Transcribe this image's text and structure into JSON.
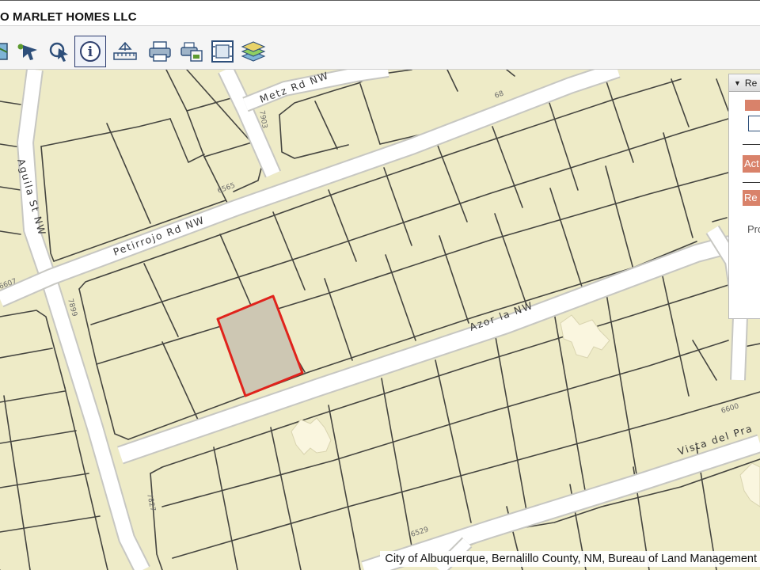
{
  "header": {
    "owner_title": "O MARLET HOMES LLC"
  },
  "toolbar": {
    "tools": [
      {
        "icon": "map-layer-icon"
      },
      {
        "icon": "select-arrow-icon"
      },
      {
        "icon": "identify-pointer-icon"
      },
      {
        "icon": "info-icon",
        "active": true
      },
      {
        "icon": "measure-icon"
      },
      {
        "icon": "print-icon"
      },
      {
        "icon": "export-icon"
      },
      {
        "icon": "full-extent-icon"
      },
      {
        "icon": "layers-icon"
      }
    ],
    "info_glyph": "i"
  },
  "map": {
    "streets": {
      "metz": "Metz Rd NW",
      "petirrojo": "Petirrojo Rd NW",
      "aguila": "Aguila St NW",
      "azor": "Azor la NW",
      "vista": "Vista del Pra"
    },
    "addresses": {
      "a1": "7903",
      "a2": "6565",
      "a3": "6607",
      "a4": "7899",
      "a5": "7827",
      "a6": "6529",
      "a7": "68",
      "a8": "6600"
    },
    "colors": {
      "parcel_fill": "#eeebc7",
      "parcel_line": "#454540",
      "road_fill": "#ffffff",
      "road_edge": "#c7c7c2",
      "selected_fill": "#cdc7b3",
      "selected_outline": "#e0231c",
      "building_fill": "#faf6df"
    }
  },
  "panel": {
    "title": "Re",
    "active_button": "Act",
    "second_button": "Re",
    "prop_text": "Pro"
  },
  "attribution": {
    "text": "City of Albuquerque, Bernalillo County, NM, Bureau of Land Management"
  }
}
